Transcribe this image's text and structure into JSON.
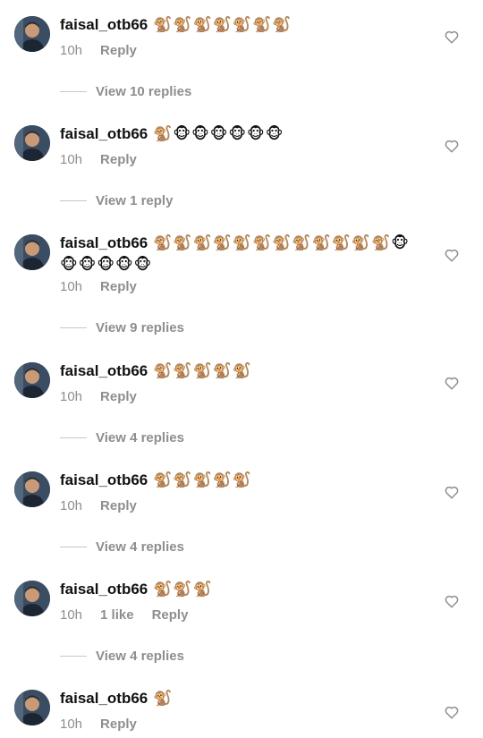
{
  "comments": [
    {
      "username": "faisal_otb66",
      "text": "🐒🐒🐒🐒🐒🐒🐒",
      "time": "10h",
      "likes": "",
      "reply": "Reply",
      "view_replies": "View 10 replies"
    },
    {
      "username": "faisal_otb66",
      "text": "🐒🐵🐵🐵🐵🐵🐵",
      "time": "10h",
      "likes": "",
      "reply": "Reply",
      "view_replies": "View 1 reply"
    },
    {
      "username": "faisal_otb66",
      "text": "🐒🐒🐒🐒🐒🐒🐒🐒🐒🐒🐒🐒🐵🐵🐵🐵🐵🐵",
      "time": "10h",
      "likes": "",
      "reply": "Reply",
      "view_replies": "View 9 replies"
    },
    {
      "username": "faisal_otb66",
      "text": "🐒🐒🐒🐒🐒",
      "time": "10h",
      "likes": "",
      "reply": "Reply",
      "view_replies": "View 4 replies"
    },
    {
      "username": "faisal_otb66",
      "text": "🐒🐒🐒🐒🐒",
      "time": "10h",
      "likes": "",
      "reply": "Reply",
      "view_replies": "View 4 replies"
    },
    {
      "username": "faisal_otb66",
      "text": "🐒🐒🐒",
      "time": "10h",
      "likes": "1 like",
      "reply": "Reply",
      "view_replies": "View 4 replies"
    },
    {
      "username": "faisal_otb66",
      "text": "🐒",
      "time": "10h",
      "likes": "",
      "reply": "Reply",
      "view_replies": ""
    }
  ],
  "icons": {
    "heart": "heart-outline-icon",
    "avatar": "profile-avatar"
  },
  "colors": {
    "meta_text": "#8e8e8e",
    "primary_text": "#111111"
  }
}
